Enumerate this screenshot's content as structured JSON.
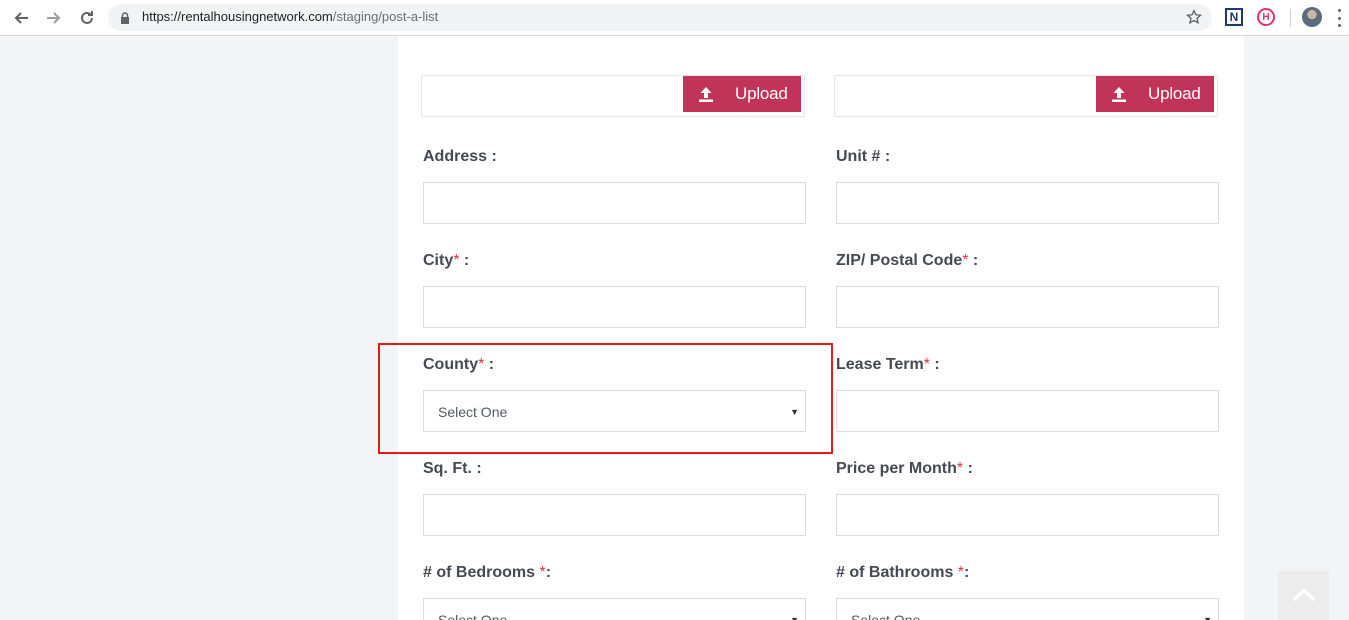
{
  "browser": {
    "url_host": "https://rentalhousingnetwork.com",
    "url_path": "/staging/post-a-list",
    "icons": [
      "back-arrow-icon",
      "forward-arrow-icon",
      "reload-icon",
      "lock-icon",
      "star-icon"
    ],
    "extensions": [
      {
        "name": "n-extension-icon",
        "glyph": "N"
      },
      {
        "name": "h-extension-icon",
        "glyph": "H"
      }
    ]
  },
  "form": {
    "upload_label": "Upload",
    "address_label": "Address :",
    "unit_label": "Unit # :",
    "city_label": "City",
    "zip_label": "ZIP/ Postal Code",
    "county_label": "County",
    "lease_label": "Lease Term",
    "sqft_label": "Sq. Ft. :",
    "price_label": "Price per Month",
    "bedrooms_label": "# of Bedrooms ",
    "bathrooms_label": "# of Bathrooms ",
    "required_mark": "*",
    "label_suffix": " :",
    "label_suffix_tight": ":",
    "county_select": "Select One",
    "bedrooms_select": "Select One",
    "bathrooms_select": "Select One"
  },
  "colors": {
    "accent": "#c0345a",
    "required": "#e0333f",
    "highlight_box": "#e21b1b"
  }
}
